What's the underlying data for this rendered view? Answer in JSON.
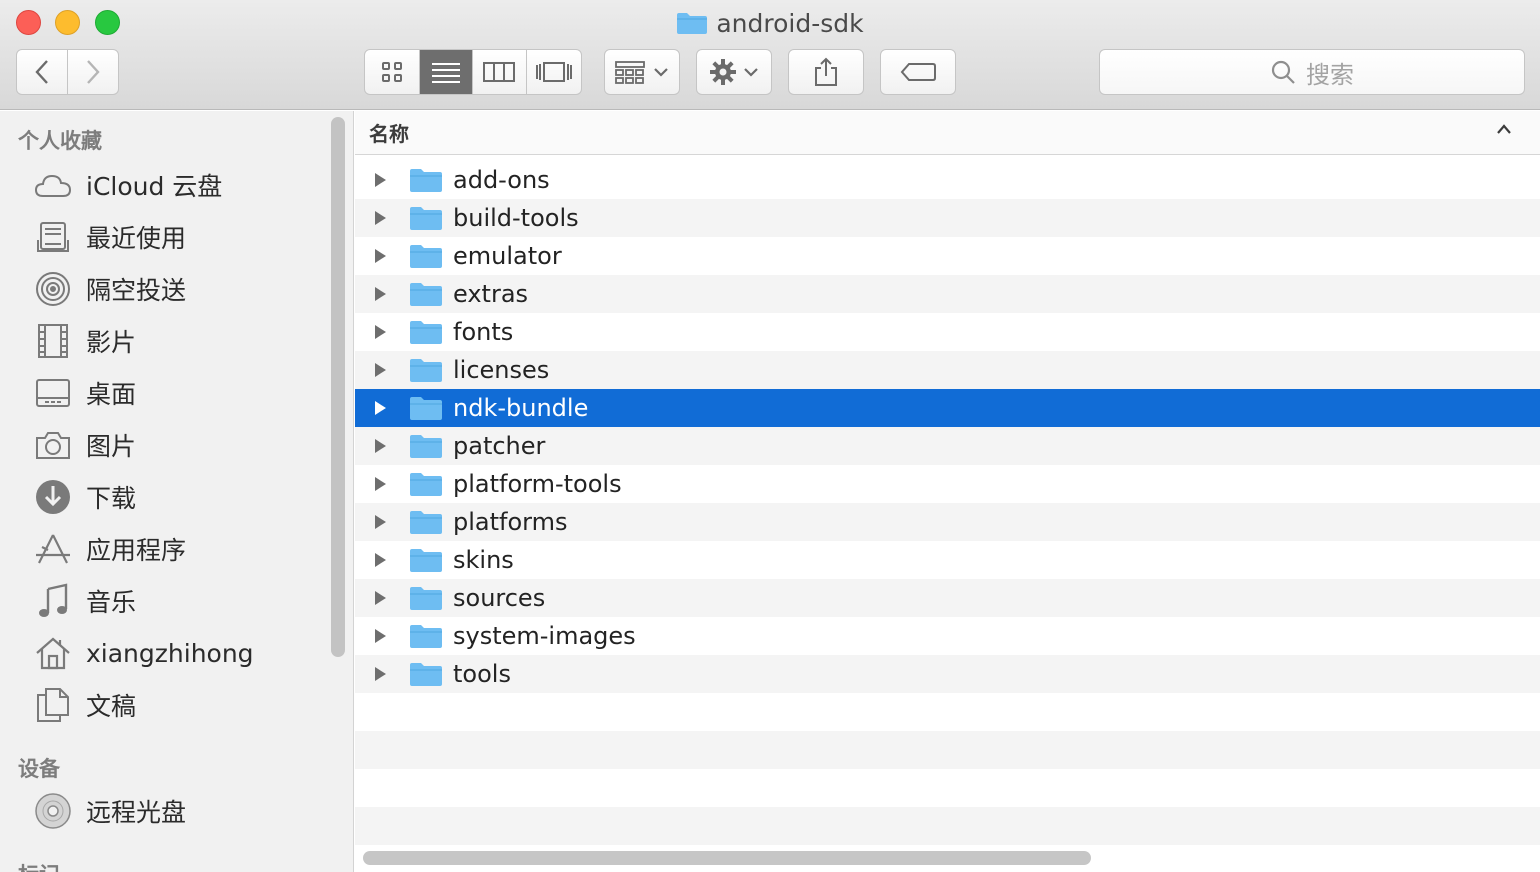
{
  "window": {
    "title": "android-sdk",
    "title_icon": "folder-icon"
  },
  "toolbar": {
    "back_icon": "chevron-left-icon",
    "forward_icon": "chevron-right-icon",
    "view_modes": [
      "icon-view",
      "list-view",
      "column-view",
      "cover-flow-view"
    ],
    "active_view": "list-view",
    "search_placeholder": "搜索"
  },
  "sidebar": {
    "favorites_title": "个人收藏",
    "favorites": [
      {
        "label": "iCloud 云盘",
        "icon": "cloud-icon"
      },
      {
        "label": "最近使用",
        "icon": "recents-icon"
      },
      {
        "label": "隔空投送",
        "icon": "airdrop-icon"
      },
      {
        "label": "影片",
        "icon": "film-icon"
      },
      {
        "label": "桌面",
        "icon": "desktop-icon"
      },
      {
        "label": "图片",
        "icon": "camera-icon"
      },
      {
        "label": "下载",
        "icon": "download-icon"
      },
      {
        "label": "应用程序",
        "icon": "applications-icon"
      },
      {
        "label": "音乐",
        "icon": "music-icon"
      },
      {
        "label": "xiangzhihong",
        "icon": "home-icon"
      },
      {
        "label": "文稿",
        "icon": "documents-icon"
      }
    ],
    "devices_title": "设备",
    "devices": [
      {
        "label": "远程光盘",
        "icon": "disc-icon"
      }
    ],
    "tags_title": "标记"
  },
  "list": {
    "column_name": "名称",
    "rows": [
      {
        "name": "add-ons"
      },
      {
        "name": "build-tools"
      },
      {
        "name": "emulator"
      },
      {
        "name": "extras"
      },
      {
        "name": "fonts"
      },
      {
        "name": "licenses"
      },
      {
        "name": "ndk-bundle",
        "selected": true
      },
      {
        "name": "patcher"
      },
      {
        "name": "platform-tools"
      },
      {
        "name": "platforms"
      },
      {
        "name": "skins"
      },
      {
        "name": "sources"
      },
      {
        "name": "system-images"
      },
      {
        "name": "tools"
      }
    ]
  },
  "colors": {
    "selection": "#116cd6",
    "folder": "#6ebdf2"
  }
}
